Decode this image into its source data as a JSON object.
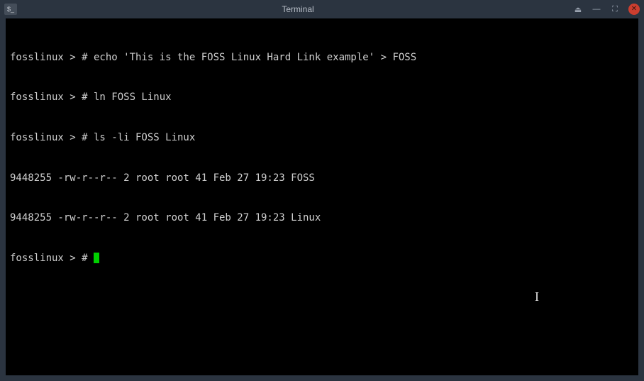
{
  "titlebar": {
    "app_icon_text": "$_",
    "title": "Terminal",
    "controls": {
      "eject": "⏏",
      "minimize": "—",
      "maximize": "⛶",
      "close": "✕"
    }
  },
  "terminal": {
    "lines": [
      "fosslinux > # echo 'This is the FOSS Linux Hard Link example' > FOSS",
      "fosslinux > # ln FOSS Linux",
      "fosslinux > # ls -li FOSS Linux",
      "9448255 -rw-r--r-- 2 root root 41 Feb 27 19:23 FOSS",
      "9448255 -rw-r--r-- 2 root root 41 Feb 27 19:23 Linux"
    ],
    "prompt": "fosslinux > # "
  }
}
